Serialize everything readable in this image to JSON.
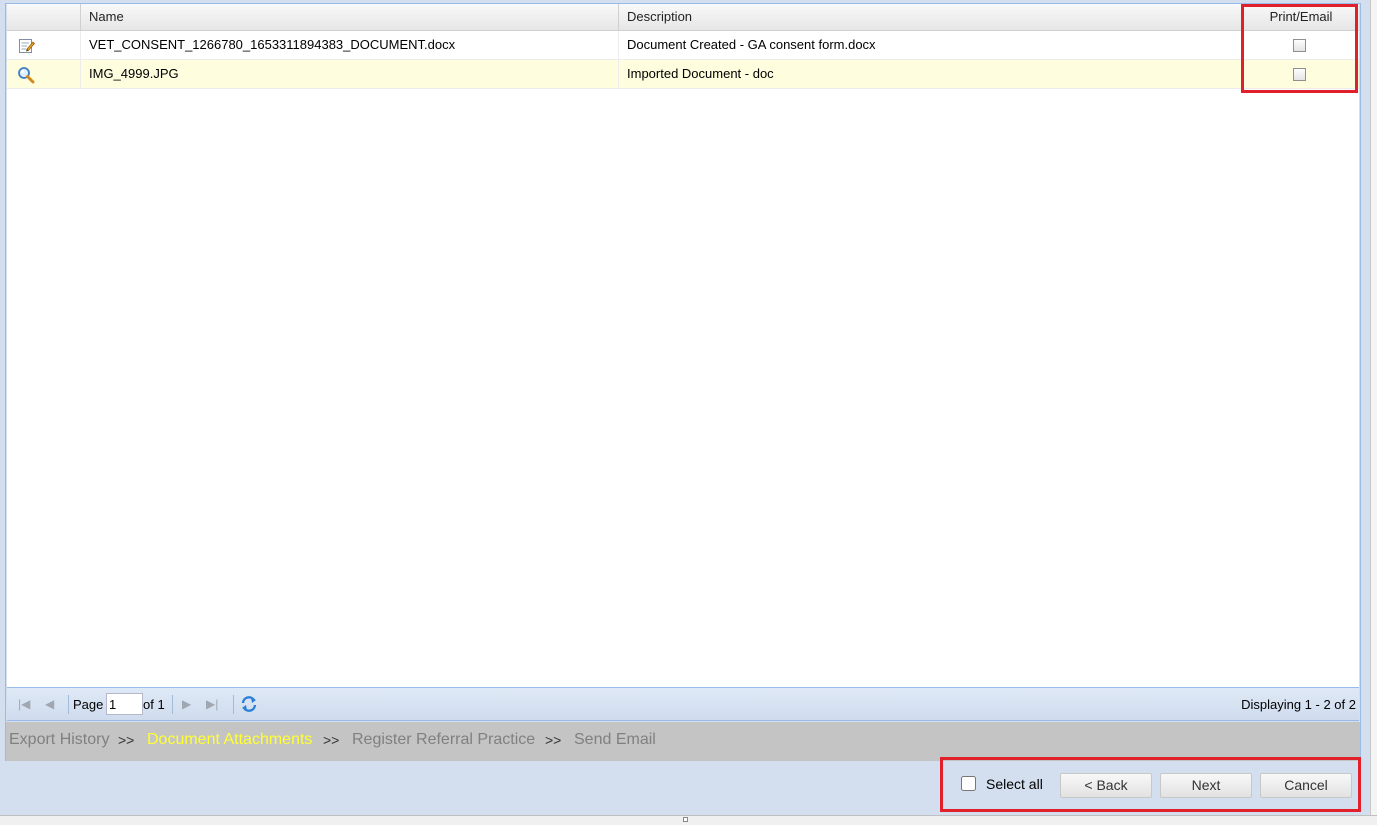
{
  "grid": {
    "columns": {
      "name": "Name",
      "description": "Description",
      "print_email": "Print/Email"
    },
    "rows": [
      {
        "icon": "edit-document-icon",
        "name": "VET_CONSENT_1266780_1653311894383_DOCUMENT.docx",
        "description": "Document Created - GA consent form.docx",
        "print_email_checked": false
      },
      {
        "icon": "magnifier-icon",
        "name": "IMG_4999.JPG",
        "description": "Imported Document - doc",
        "print_email_checked": false
      }
    ]
  },
  "pager": {
    "page_label": "Page",
    "page_value": "1",
    "of_label": "of 1",
    "display_info": "Displaying 1 - 2 of 2"
  },
  "breadcrumb": {
    "steps": [
      "Export History",
      "Document Attachments",
      "Register Referral Practice",
      "Send Email"
    ],
    "separator": ">>",
    "active_step": "Document Attachments"
  },
  "footer": {
    "select_all_label": "Select all",
    "back_label": "< Back",
    "next_label": "Next",
    "cancel_label": "Cancel"
  },
  "colors": {
    "active_step": "#ffff33",
    "highlight_box": "#e0202a",
    "selected_row": "#fefedf"
  }
}
